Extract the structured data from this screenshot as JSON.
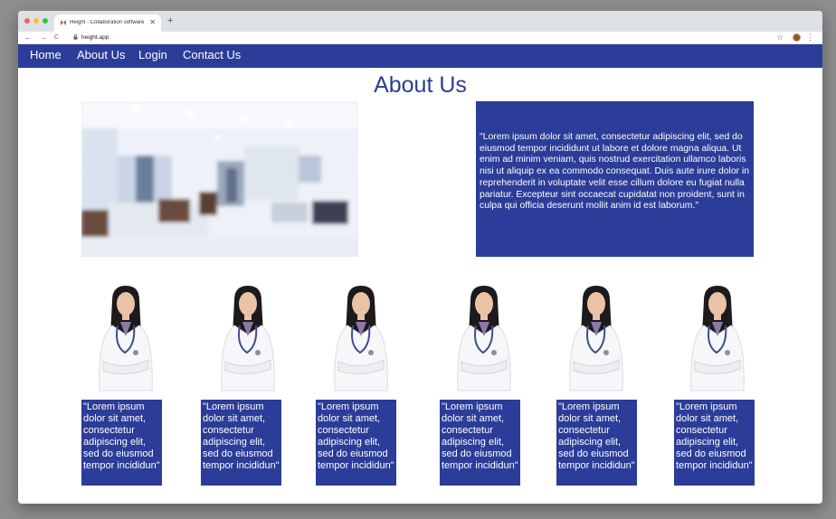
{
  "browser": {
    "tab_title": "Height - Collaboration software f",
    "tab_close": "✕",
    "new_tab": "+",
    "back": "←",
    "forward": "→",
    "reload": "C",
    "url": "height.app",
    "star": "☆",
    "menu": "⋮"
  },
  "nav": {
    "items": [
      "Home",
      "About Us",
      "Login",
      "Contact Us"
    ]
  },
  "page": {
    "title": "About Us",
    "paragraph": "\"Lorem ipsum dolor sit amet, consectetur adipiscing elit, sed do eiusmod tempor incididunt ut labore et dolore magna aliqua. Ut enim ad minim veniam, quis nostrud exercitation ullamco laboris nisi ut aliquip ex ea commodo consequat. Duis aute irure dolor in reprehenderit in voluptate velit esse cillum dolore eu fugiat nulla pariatur. Excepteur sint occaecat cupidatat non proident, sunt in culpa qui officia deserunt mollit anim id est laborum.\"",
    "team_captions": [
      "\"Lorem ipsum dolor sit amet, consectetur adipiscing elit, sed do eiusmod tempor incididun\"",
      "\"Lorem ipsum dolor sit amet, consectetur adipiscing elit, sed do eiusmod tempor incididun\"",
      "\"Lorem ipsum dolor sit amet, consectetur adipiscing elit, sed do eiusmod tempor incididun\"",
      "\"Lorem ipsum dolor sit amet, consectetur adipiscing elit, sed do eiusmod tempor incididun\"",
      "\"Lorem ipsum dolor sit amet, consectetur adipiscing elit, sed do eiusmod tempor incididun\"",
      "\"Lorem ipsum dolor sit amet, consectetur adipiscing elit, sed do eiusmod tempor incididun\""
    ]
  },
  "colors": {
    "brand_blue": "#2b3d98",
    "page_bg": "#ffffff",
    "desktop_bg": "#8e8e8e"
  },
  "icons": [
    "close-icon",
    "plus-icon",
    "back-arrow-icon",
    "forward-arrow-icon",
    "reload-icon",
    "lock-icon",
    "star-icon",
    "profile-avatar",
    "menu-dots-icon"
  ]
}
